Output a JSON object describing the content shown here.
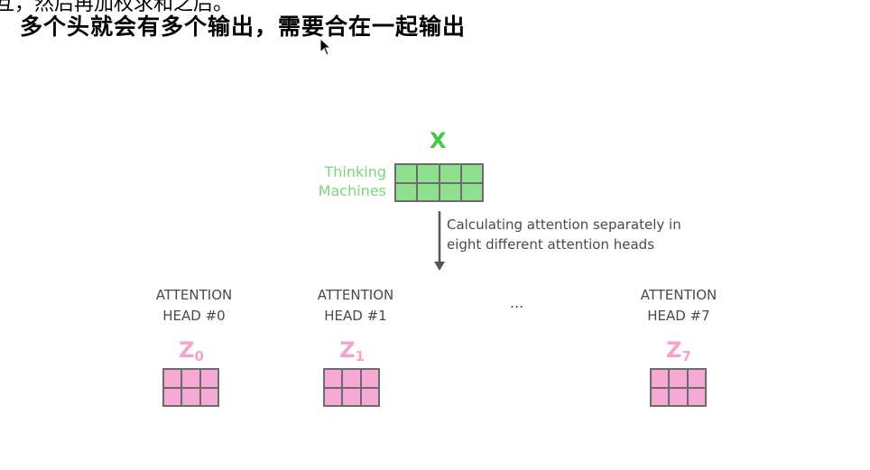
{
  "top_cut_text": "互，然后再加权求和之后。",
  "caption": "多个头就会有多个输出，需要合在一起输出",
  "input": {
    "label": "X",
    "words": [
      "Thinking",
      "Machines"
    ],
    "color": "#3fc94a"
  },
  "process_note": {
    "line1": "Calculating attention separately in",
    "line2": "eight different attention heads"
  },
  "ellipsis": "...",
  "heads": [
    {
      "line1": "ATTENTION",
      "line2": "HEAD #0",
      "z_letter": "Z",
      "z_sub": "0"
    },
    {
      "line1": "ATTENTION",
      "line2": "HEAD #1",
      "z_letter": "Z",
      "z_sub": "1"
    },
    {
      "line1": "ATTENTION",
      "line2": "HEAD #7",
      "z_letter": "Z",
      "z_sub": "7"
    }
  ],
  "colors": {
    "input_cells": "#8ee08e",
    "output_cells": "#f7a9d5",
    "output_label": "#f4a3cf",
    "text": "#4a4a4a"
  }
}
